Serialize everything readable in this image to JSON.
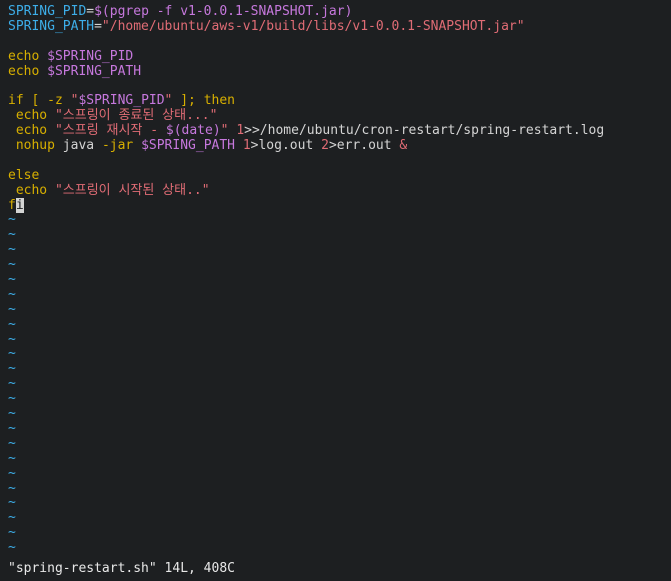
{
  "editor": {
    "lines": [
      [
        {
          "t": "SPRING_PID",
          "c": "var"
        },
        {
          "t": "=",
          "c": "default"
        },
        {
          "t": "$(pgrep -f v1-0.0.1-SNAPSHOT.jar)",
          "c": "sub"
        }
      ],
      [
        {
          "t": "SPRING_PATH",
          "c": "var"
        },
        {
          "t": "=",
          "c": "default"
        },
        {
          "t": "\"/home/ubuntu/aws-v1/build/libs/v1-0.0.1-SNAPSHOT.jar\"",
          "c": "str"
        }
      ],
      [],
      [
        {
          "t": "echo ",
          "c": "kw"
        },
        {
          "t": "$SPRING_PID",
          "c": "sub"
        }
      ],
      [
        {
          "t": "echo ",
          "c": "kw"
        },
        {
          "t": "$SPRING_PATH",
          "c": "sub"
        }
      ],
      [],
      [
        {
          "t": "if",
          "c": "kw"
        },
        {
          "t": " [ ",
          "c": "kw"
        },
        {
          "t": "-z",
          "c": "kw"
        },
        {
          "t": " \"",
          "c": "str"
        },
        {
          "t": "$SPRING_PID",
          "c": "sub"
        },
        {
          "t": "\"",
          "c": "str"
        },
        {
          "t": " ]; ",
          "c": "kw"
        },
        {
          "t": "then",
          "c": "kw"
        }
      ],
      [
        {
          "t": " echo ",
          "c": "kw"
        },
        {
          "t": "\"스프링이 종료된 상태...\"",
          "c": "str"
        }
      ],
      [
        {
          "t": " echo ",
          "c": "kw"
        },
        {
          "t": "\"스프링 재시작 - ",
          "c": "str"
        },
        {
          "t": "$(date)",
          "c": "sub"
        },
        {
          "t": "\"",
          "c": "str"
        },
        {
          "t": " 1",
          "c": "num"
        },
        {
          "t": ">>/home/ubuntu/cron-restart/spring-restart.log",
          "c": "default"
        }
      ],
      [
        {
          "t": " nohup",
          "c": "kw"
        },
        {
          "t": " java ",
          "c": "default"
        },
        {
          "t": "-jar",
          "c": "kw"
        },
        {
          "t": " ",
          "c": "default"
        },
        {
          "t": "$SPRING_PATH",
          "c": "sub"
        },
        {
          "t": " 1",
          "c": "num"
        },
        {
          "t": ">log.out ",
          "c": "default"
        },
        {
          "t": "2",
          "c": "num"
        },
        {
          "t": ">err.out ",
          "c": "default"
        },
        {
          "t": "&",
          "c": "str"
        }
      ],
      [],
      [
        {
          "t": "else",
          "c": "kw"
        }
      ],
      [
        {
          "t": " echo ",
          "c": "kw"
        },
        {
          "t": "\"스프링이 시작된 상태..\"",
          "c": "str"
        }
      ],
      [
        {
          "t": "f",
          "c": "kw"
        },
        {
          "t": "i",
          "c": "cursor"
        }
      ]
    ],
    "empty_marker": "~",
    "empty_count": 23
  },
  "status": {
    "filename": "\"spring-restart.sh\"",
    "info": " 14L, 408C"
  },
  "colors": {
    "background": "#1d1f21",
    "variable": "#3daee9",
    "keyword": "#d7af00",
    "string": "#e06c75",
    "substitution": "#c678dd"
  }
}
